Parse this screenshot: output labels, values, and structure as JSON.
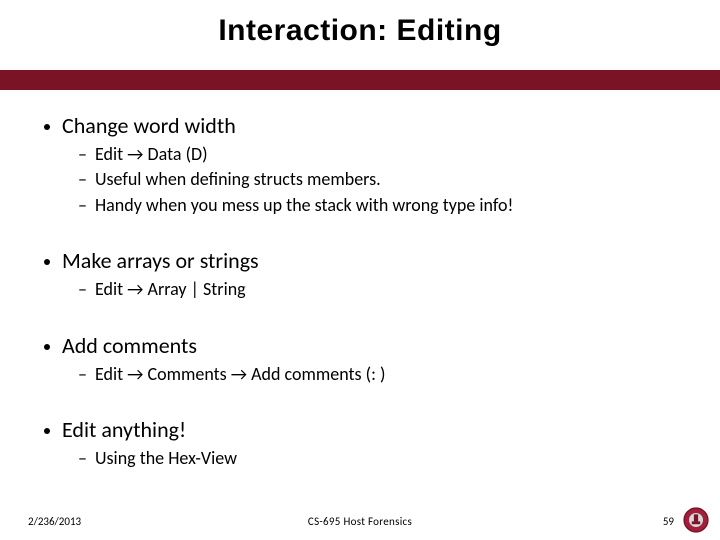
{
  "title": "Interaction: Editing",
  "bullets": [
    {
      "text": "Change word width",
      "subs": [
        "Edit → Data (D)",
        "Useful when defining structs members.",
        "Handy when you mess up the stack with wrong type info!"
      ]
    },
    {
      "text": "Make arrays or strings",
      "subs": [
        "Edit → Array | String"
      ]
    },
    {
      "text": "Add comments",
      "subs": [
        "Edit → Comments →  Add comments (: )"
      ]
    },
    {
      "text": "Edit anything!",
      "subs": [
        "Using the Hex-View"
      ]
    }
  ],
  "footer": {
    "date": "2/236/2013",
    "center": "CS-695 Host Forensics",
    "page": "59"
  }
}
